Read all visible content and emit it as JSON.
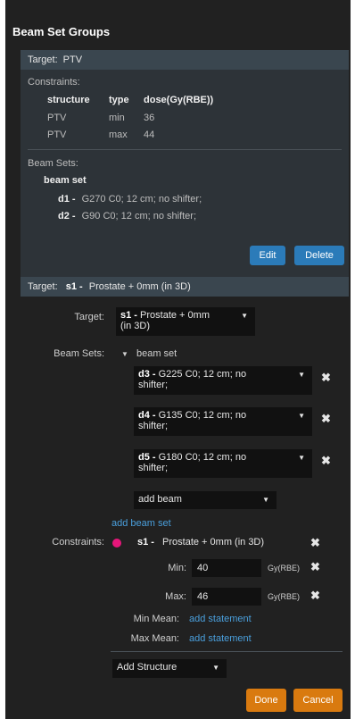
{
  "panel": {
    "title": "Beam Set Groups"
  },
  "group": {
    "target_label": "Target:",
    "target_value": "PTV",
    "constraints_label": "Constraints:",
    "table": {
      "headers": [
        "structure",
        "type",
        "dose(Gy(RBE))"
      ],
      "rows": [
        [
          "PTV",
          "min",
          "36"
        ],
        [
          "PTV",
          "max",
          "44"
        ]
      ]
    },
    "beam_sets_label": "Beam Sets:",
    "beam_set_name": "beam set",
    "beams": [
      {
        "id": "d1 -",
        "desc": "G270 C0; 12 cm; no shifter;"
      },
      {
        "id": "d2 -",
        "desc": "G90 C0; 12 cm; no shifter;"
      }
    ],
    "edit_label": "Edit",
    "delete_label": "Delete",
    "footer_target_label": "Target:",
    "footer_target_id": "s1 -",
    "footer_target_desc": "Prostate + 0mm (in 3D)"
  },
  "editor": {
    "target_label": "Target:",
    "target_select": {
      "id": "s1 -",
      "line1": "Prostate + 0mm",
      "line2": "(in 3D)"
    },
    "beam_sets_label": "Beam Sets:",
    "beam_set_name": "beam set",
    "beams": [
      {
        "id": "d3 -",
        "line1": "G225 C0; 12 cm; no",
        "line2": "shifter;"
      },
      {
        "id": "d4 -",
        "line1": "G135 C0; 12 cm; no",
        "line2": "shifter;"
      },
      {
        "id": "d5 -",
        "line1": "G180 C0; 12 cm; no",
        "line2": "shifter;"
      }
    ],
    "add_beam_placeholder": "add beam",
    "add_beam_set_link": "add beam set",
    "constraints_label": "Constraints:",
    "constraint_structure_id": "s1 -",
    "constraint_structure_desc": "Prostate + 0mm (in 3D)",
    "constraint_color": "#e6167a",
    "min_label": "Min:",
    "min_value": "40",
    "max_label": "Max:",
    "max_value": "46",
    "unit": "Gy(RBE)",
    "min_mean_label": "Min Mean:",
    "max_mean_label": "Max Mean:",
    "add_statement_link": "add statement",
    "add_structure_placeholder": "Add Structure",
    "done_label": "Done",
    "cancel_label": "Cancel"
  }
}
